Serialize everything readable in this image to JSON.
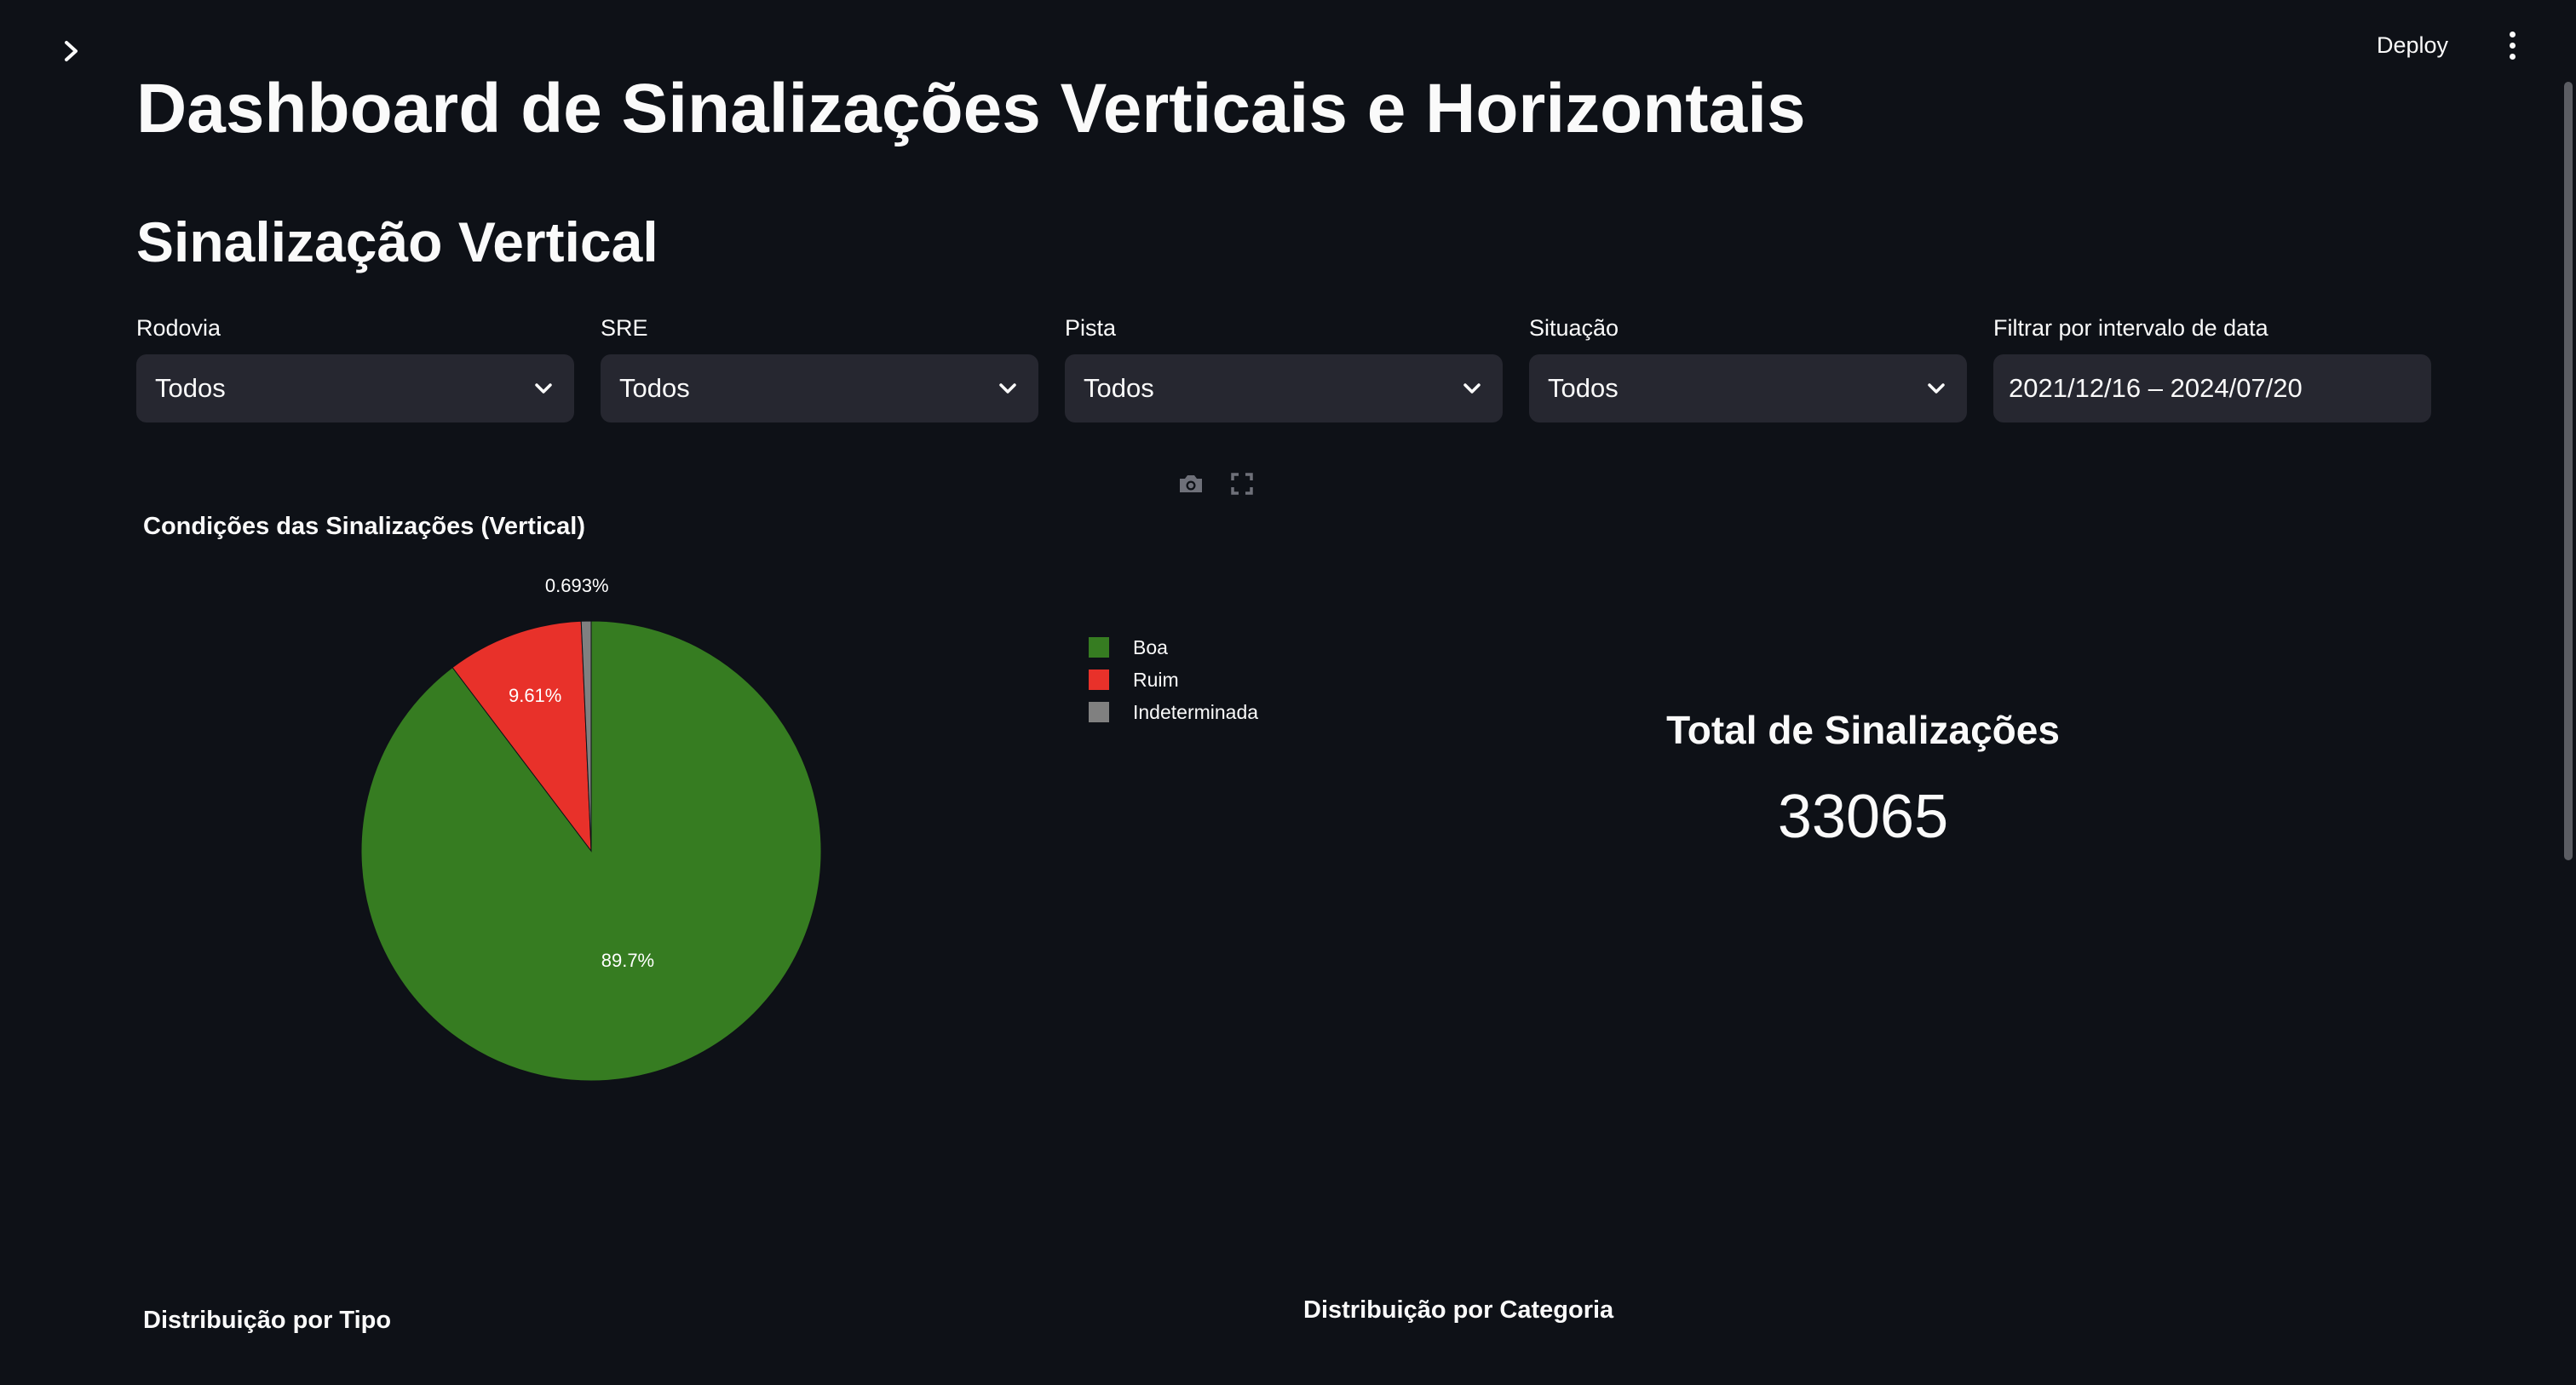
{
  "header": {
    "deploy_label": "Deploy",
    "sidebar_toggle_icon": "chevron-right-icon",
    "menu_icon": "kebab-menu-icon"
  },
  "page": {
    "title": "Dashboard de Sinalizações Verticais e Horizontais",
    "section_title": "Sinalização Vertical"
  },
  "filters": [
    {
      "label": "Rodovia",
      "value": "Todos"
    },
    {
      "label": "SRE",
      "value": "Todos"
    },
    {
      "label": "Pista",
      "value": "Todos"
    },
    {
      "label": "Situação",
      "value": "Todos"
    },
    {
      "label": "Filtrar por intervalo de data",
      "value": "2021/12/16 – 2024/07/20"
    }
  ],
  "chart_toolbar": {
    "icons": [
      "camera-icon",
      "fullscreen-icon"
    ]
  },
  "chart_data": {
    "type": "pie",
    "title": "Condições das Sinalizações (Vertical)",
    "categories": [
      "Boa",
      "Ruim",
      "Indeterminada"
    ],
    "values": [
      89.7,
      9.61,
      0.693
    ],
    "labels": [
      "89.7%",
      "9.61%",
      "0.693%"
    ],
    "colors": [
      "#367c21",
      "#e8312a",
      "#808080"
    ],
    "legend_position": "right"
  },
  "metric": {
    "label": "Total de Sinalizações",
    "value": "33065"
  },
  "subsections": {
    "tipo_title": "Distribuição por Tipo",
    "categoria_title": "Distribuição por Categoria"
  }
}
